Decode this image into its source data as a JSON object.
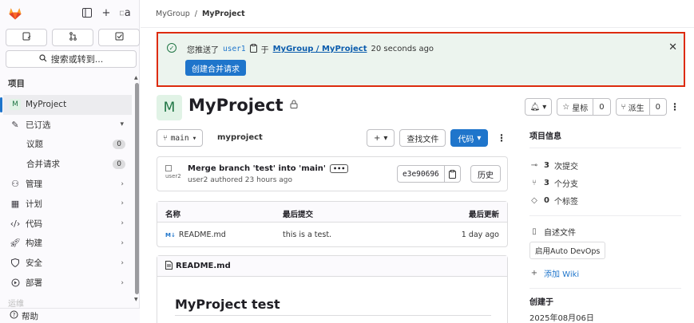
{
  "sidebar": {
    "search_label": "搜索或转到...",
    "section_title": "项目",
    "project_initial": "M",
    "project_name": "MyProject",
    "pinned": {
      "label": "已订选"
    },
    "issues": {
      "label": "议题",
      "count": "0"
    },
    "merge_requests": {
      "label": "合并请求",
      "count": "0"
    },
    "items": [
      {
        "label": "管理",
        "icon": "manage-icon"
      },
      {
        "label": "计划",
        "icon": "plan-icon"
      },
      {
        "label": "代码",
        "icon": "code-icon"
      },
      {
        "label": "构建",
        "icon": "rocket-icon"
      },
      {
        "label": "安全",
        "icon": "shield-icon"
      },
      {
        "label": "部署",
        "icon": "deploy-icon"
      }
    ],
    "faded_item": "运维",
    "help_label": "帮助",
    "avatar_alt": "a"
  },
  "breadcrumb": {
    "group": "MyGroup",
    "separator": "/",
    "project": "MyProject"
  },
  "alert": {
    "prefix": "您推送了",
    "user": "user1",
    "in": "于",
    "link": "MyGroup / MyProject",
    "time": "20 seconds ago",
    "button": "创建合并请求"
  },
  "project": {
    "initial": "M",
    "title": "MyProject",
    "star_label": "星标",
    "star_count": "0",
    "fork_label": "派生",
    "fork_count": "0"
  },
  "repo": {
    "branch": "main",
    "path": "myproject",
    "find_file": "查找文件",
    "code_button": "代码"
  },
  "commit": {
    "avatar_alt": "user2",
    "title": "Merge branch 'test' into 'main'",
    "ellipsis": "•••",
    "author": "user2",
    "authored_text": "authored 23 hours ago",
    "sha": "e3e90696",
    "history": "历史"
  },
  "files": {
    "headers": {
      "name": "名称",
      "last_commit": "最后提交",
      "last_update": "最后更新"
    },
    "rows": [
      {
        "name": "README.md",
        "commit": "this is a test.",
        "updated": "1 day ago"
      }
    ]
  },
  "readme": {
    "filename": "README.md",
    "heading": "MyProject test"
  },
  "info": {
    "title": "项目信息",
    "commits_count": "3",
    "commits_label": "次提交",
    "branches_count": "3",
    "branches_label": "个分支",
    "tags_count": "0",
    "tags_label": "个标签",
    "autodevops_label": "自述文件",
    "autodevops_button": "启用Auto DevOps",
    "add_wiki": "添加 Wiki",
    "created_label": "创建于",
    "created_date": "2025年08月06日"
  },
  "colors": {
    "accent": "#1f75cb",
    "success_bg": "#ecf4ee",
    "highlight_border": "#dd2b0e"
  }
}
